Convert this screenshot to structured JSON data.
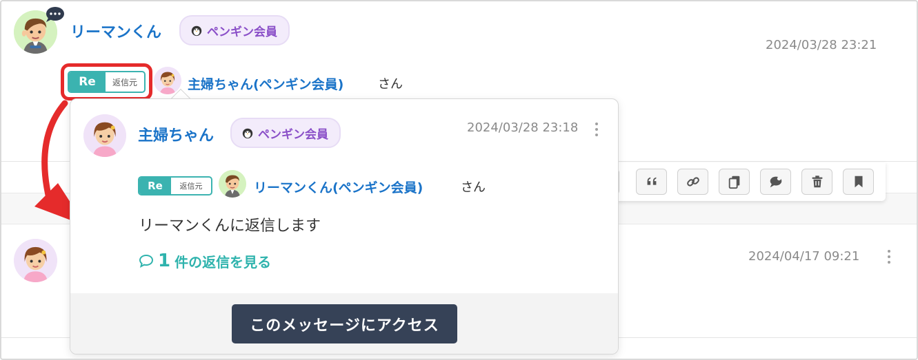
{
  "main_post": {
    "author": "リーマンくん",
    "badge": "ペンギン会員",
    "timestamp": "2024/03/28 23:21",
    "reply_ref": {
      "re_label": "Re",
      "source_label": "返信元",
      "target_name": "主婦ちゃん(ペンギン会員)",
      "suffix": "さん"
    }
  },
  "popup": {
    "author": "主婦ちゃん",
    "badge": "ペンギン会員",
    "timestamp": "2024/03/28 23:18",
    "reply_ref": {
      "re_label": "Re",
      "source_label": "返信元",
      "target_name": "リーマンくん(ペンギン会員)",
      "suffix": "さん"
    },
    "message": "リーマンくんに返信します",
    "replies_count": "1",
    "replies_text": "件の返信を見る",
    "access_button": "このメッセージにアクセス"
  },
  "second_post": {
    "timestamp": "2024/04/17 09:21"
  },
  "toolbar": {
    "buttons": [
      "quote-icon",
      "link-icon",
      "copy-icon",
      "reply-bubble-icon",
      "trash-icon",
      "bookmark-icon"
    ]
  },
  "colors": {
    "name_blue": "#1a73c8",
    "badge_purple": "#8a4fc8",
    "re_teal": "#3bb3b0",
    "highlight_red": "#e52b2b",
    "button_dark": "#364257"
  }
}
